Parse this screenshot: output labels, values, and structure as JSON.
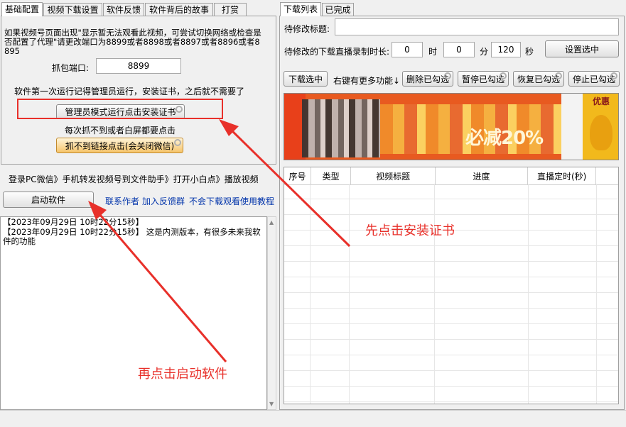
{
  "left_tabs": [
    "基础配置",
    "视频下载设置",
    "软件反馈",
    "软件背后的故事",
    "打赏"
  ],
  "right_tabs": [
    "下载列表",
    "已完成"
  ],
  "config": {
    "notice": "如果视频号页面出现\"显示暂无法观看此视频，可尝试切换网络或检查是否配置了代理\"请更改端口为8899或者8898或者8897或者8896或者8895",
    "port_label": "抓包端口:",
    "port_value": "8899",
    "admin_tip": "软件第一次运行记得管理员运行，安装证书，之后就不需要了",
    "admin_button": "管理员模式运行点击安装证书",
    "white_screen_tip": "每次抓不到或者白屏都要点击",
    "link_button": "抓不到链接点击(会关闭微信)"
  },
  "steps_text": "登录PC微信》手机转发视频号到文件助手》打开小白点》播放视频",
  "start_button": "启动软件",
  "links": [
    "联系作者",
    "加入反馈群",
    "不会下载观看使用教程"
  ],
  "log": [
    "【2023年09月29日 10时22分15秒】",
    "【2023年09月29日 10时22分15秒】 这是内测版本，有很多未来我软件的功能"
  ],
  "right": {
    "title_label": "待修改标题:",
    "title_value": "",
    "duration_label": "待修改的下载直播录制时长:",
    "hours": "0",
    "hour_unit": "时",
    "minutes": "0",
    "minute_unit": "分",
    "seconds": "120",
    "second_unit": "秒",
    "set_button": "设置选中",
    "download_button": "下载选中",
    "more_hint": "右键有更多功能↓",
    "delete_button": "删除已勾选",
    "pause_button": "暂停已勾选",
    "resume_button": "恢复已勾选",
    "stop_button": "停止已勾选",
    "banner_text": "必减20%",
    "banner_badge": "优惠",
    "columns": [
      "序号",
      "类型",
      "视频标题",
      "进度",
      "直播定时(秒)"
    ]
  },
  "annotations": {
    "first": "先点击安装证书",
    "second": "再点击启动软件",
    "arrow_color": "#e8302a"
  }
}
